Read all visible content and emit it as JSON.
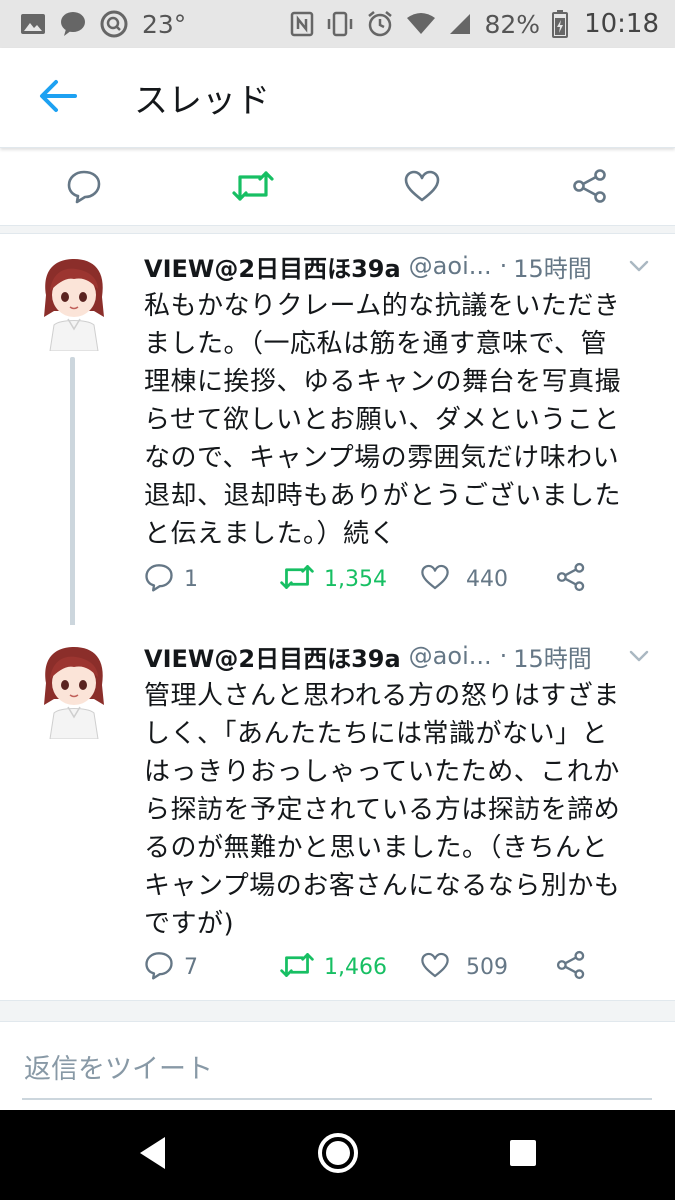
{
  "status_bar": {
    "temperature": "23°",
    "battery": "82%",
    "time": "10:18",
    "icons_left": [
      "photo-icon",
      "chat-bubble-icon",
      "search-icon"
    ],
    "icons_right": [
      "nfc-icon",
      "vibrate-icon",
      "alarm-icon",
      "wifi-icon",
      "signal-icon",
      "battery-icon"
    ]
  },
  "app_bar": {
    "back_icon": "arrow-left-icon",
    "title": "スレッド"
  },
  "top_actions": [
    "reply-icon",
    "retweet-icon",
    "like-icon",
    "share-icon"
  ],
  "tweets": [
    {
      "name": "VIEW@2日目西ほ39a",
      "handle": "@aoi...",
      "separator": "·",
      "time": "15時間",
      "lines": [
        "私もかなりクレーム的な抗議をいただき",
        "ました。（一応私は筋を通す意味で、管",
        "理棟に挨拶、ゆるキャンの舞台を写真撮",
        "らせて欲しいとお願い、ダメということ",
        "なので、キャンプ場の雰囲気だけ味わい",
        "退却、退却時もありがとうございました",
        "と伝えました。）続く"
      ],
      "replies": "1",
      "retweets": "1,354",
      "likes": "440"
    },
    {
      "name": "VIEW@2日目西ほ39a",
      "handle": "@aoi...",
      "separator": "·",
      "time": "15時間",
      "lines": [
        "管理人さんと思われる方の怒りはすざま",
        "しく、「あんたたちには常識がない」と",
        "はっきりおっしゃっていたため、これか",
        "ら探訪を予定されている方は探訪を諦め",
        "るのが無難かと思いました。（きちんと",
        "キャンプ場のお客さんになるなら別かも",
        "ですが)"
      ],
      "replies": "7",
      "retweets": "1,466",
      "likes": "509"
    }
  ],
  "reply_box": {
    "placeholder": "返信をツイート"
  },
  "nav_bar": [
    "back-triangle-icon",
    "home-circle-icon",
    "recents-square-icon"
  ],
  "colors": {
    "accent": "#1da1f2",
    "retweet_green": "#17bf63",
    "muted": "#657786",
    "text": "#14171a"
  }
}
